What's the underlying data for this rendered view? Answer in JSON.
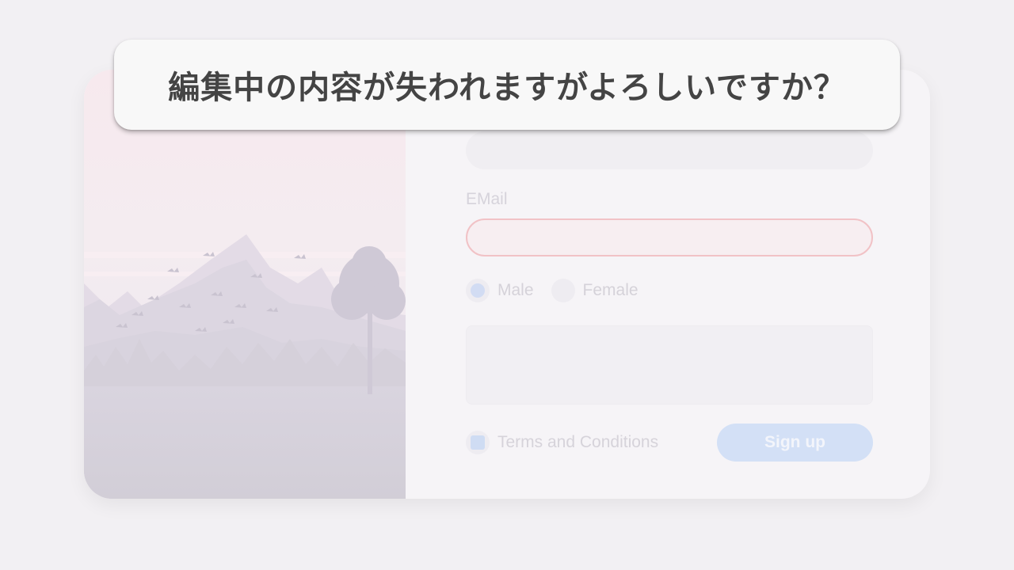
{
  "dialog": {
    "message": "編集中の内容が失われますがよろしいですか？"
  },
  "form": {
    "name_value": "",
    "email_label": "EMail",
    "email_value": "",
    "gender_options": [
      "Male",
      "Female"
    ],
    "gender_selected": "Male",
    "message_value": "",
    "terms_label": "Terms and Conditions",
    "terms_checked": true,
    "signup_label": "Sign up"
  },
  "colors": {
    "background": "#f2f0f3",
    "accent": "#d3e0f6",
    "error_border": "#f1c2c6",
    "toast_text": "#444444"
  }
}
